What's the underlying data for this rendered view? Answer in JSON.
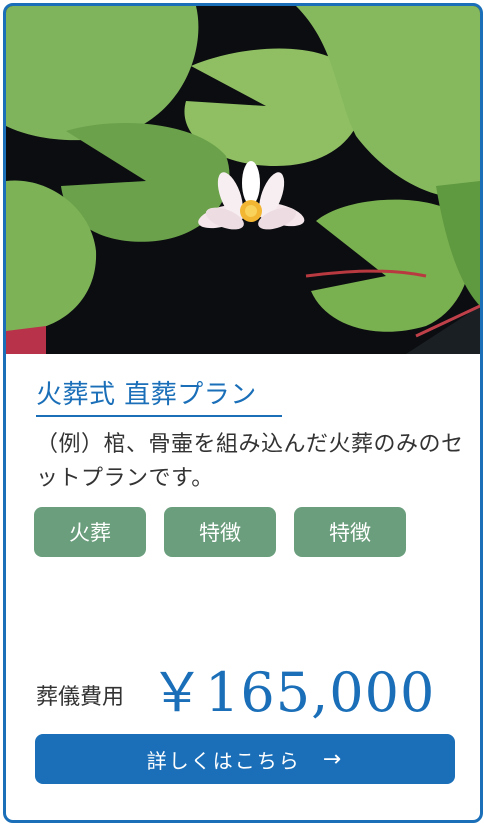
{
  "plan": {
    "image_alt_icon": "water-lily-photo",
    "title": "火葬式 直葬プラン",
    "description": "（例）棺、骨壷を組み込んだ火葬のみのセットプランです。",
    "tags": [
      "火葬",
      "特徴",
      "特徴"
    ],
    "price_label": "葬儀費用",
    "price_value": "￥165,000",
    "cta_label": "詳しくはこちら",
    "cta_arrow": "→"
  },
  "colors": {
    "accent": "#1a6fb8",
    "tag_bg": "#6a9e7c",
    "text": "#333333"
  }
}
